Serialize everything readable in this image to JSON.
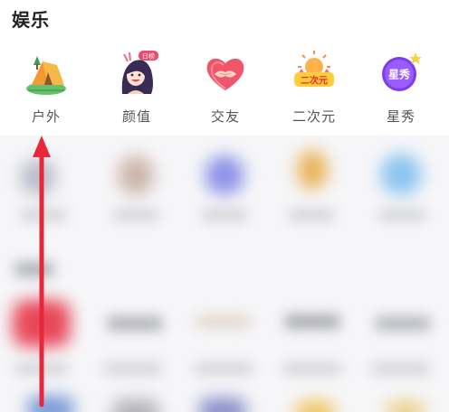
{
  "section": {
    "title": "娱乐"
  },
  "categories": [
    {
      "label": "户外",
      "icon": "tent-icon"
    },
    {
      "label": "颜值",
      "icon": "girl-avatar-icon"
    },
    {
      "label": "交友",
      "icon": "heart-handshake-icon"
    },
    {
      "label": "二次元",
      "icon": "anime-logo-icon"
    },
    {
      "label": "星秀",
      "icon": "star-show-icon"
    }
  ],
  "badge": {
    "text": "日榜"
  },
  "icon_texts": {
    "anime": "二次元",
    "star_show": "星秀"
  },
  "colors": {
    "accent_red": "#e8283a",
    "heart_red": "#f0556a",
    "purple": "#7b3cf0",
    "tent_green": "#5cc065"
  }
}
